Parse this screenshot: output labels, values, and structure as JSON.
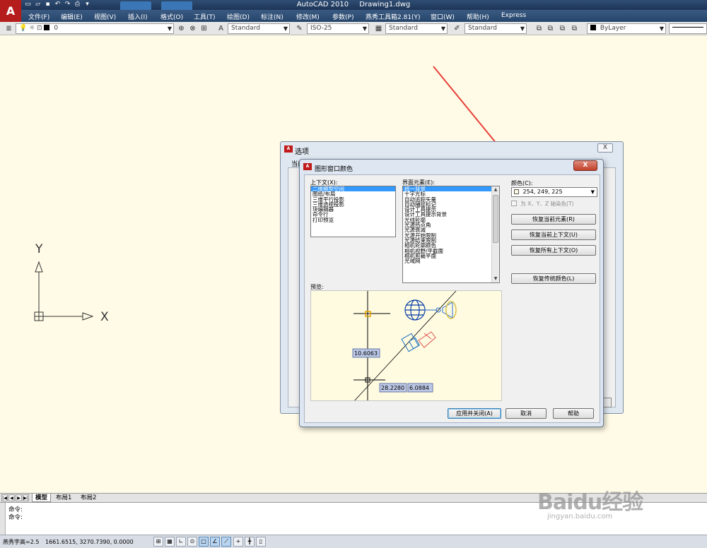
{
  "window": {
    "app": "AutoCAD 2010",
    "document": "Drawing1.dwg"
  },
  "menu": [
    "文件(F)",
    "编辑(E)",
    "视图(V)",
    "插入(I)",
    "格式(O)",
    "工具(T)",
    "绘图(D)",
    "标注(N)",
    "修改(M)",
    "参数(P)",
    "燕秀工具箱2.81(Y)",
    "窗口(W)",
    "帮助(H)",
    "Express"
  ],
  "toolbar": {
    "layer": "0",
    "text_style": "Standard",
    "dim_style": "ISO-25",
    "table_style": "Standard",
    "mleader_style": "Standard",
    "color": "ByLayer"
  },
  "ucs": {
    "x_label": "X",
    "y_label": "Y"
  },
  "options_dialog": {
    "title": "选项",
    "tab_label": "当前",
    "close": "X"
  },
  "color_dialog": {
    "title": "图形窗口颜色",
    "close": "X",
    "context_label": "上下文(X):",
    "contexts": [
      "二维模型空间",
      "图纸/布局",
      "三维平行投影",
      "三维透视投影",
      "块编辑器",
      "命令行",
      "打印预览"
    ],
    "element_label": "界面元素(E):",
    "elements": [
      "统一背景",
      "十字光标",
      "自动追踪矢量",
      "自动捕捉标记",
      "设计工具提示",
      "设计工具提示背景",
      "光线轮廓",
      "光源热点角",
      "光源衰减",
      "光源开始限制",
      "光源结束限制",
      "相机轮廓颜色",
      "相机视野/平截面",
      "相机剪裁平面",
      "光域网"
    ],
    "color_label": "颜色(C):",
    "color_value": "254, 249, 225",
    "tint_label": "为 X、Y、Z 轴染色(T)",
    "restore_element": "恢复当前元素(R)",
    "restore_context": "恢复当前上下文(U)",
    "restore_all": "恢复所有上下文(O)",
    "restore_classic": "恢复传统颜色(L)",
    "preview_label": "预览:",
    "preview_values": {
      "v1": "10.6063",
      "v2": "28.2280",
      "v3": "6.0884"
    },
    "apply_close": "应用并关闭(A)",
    "cancel": "取消",
    "help": "帮助"
  },
  "layout_tabs": [
    "模型",
    "布局1",
    "布局2"
  ],
  "command_lines": [
    "命令:",
    "命令:"
  ],
  "status": {
    "text_height": "燕秀字高=2.5",
    "coords": "1661.6515,  3270.7390,  0.0000"
  },
  "watermark": {
    "main": "Baidu经验",
    "sub": "jingyan.baidu.com"
  }
}
